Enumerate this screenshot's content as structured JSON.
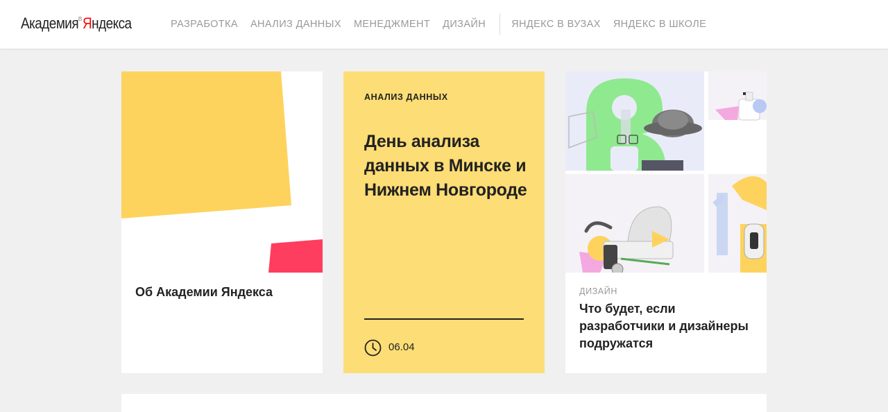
{
  "header": {
    "logo": {
      "word1": "Академия",
      "sup": "в",
      "word2_first": "Я",
      "word2_rest": "ндекса"
    },
    "nav": [
      {
        "label": "РАЗРАБОТКА"
      },
      {
        "label": "АНАЛИЗ ДАННЫХ"
      },
      {
        "label": "МЕНЕДЖМЕНТ"
      },
      {
        "label": "ДИЗАЙН"
      }
    ],
    "nav_secondary": [
      {
        "label": "ЯНДЕКС В ВУЗАХ"
      },
      {
        "label": "ЯНДЕКС В ШКОЛЕ"
      }
    ]
  },
  "cards": {
    "about": {
      "title": "Об Академии Яндекса"
    },
    "event": {
      "tag": "АНАЛИЗ ДАННЫХ",
      "title": "День анализа данных в Минске и Нижнем Новгороде",
      "date": "06.04"
    },
    "article": {
      "tag": "ДИЗАЙН",
      "title": "Что будет, если разработчики и дизайнеры подружатся"
    }
  },
  "colors": {
    "yellow": "#fdd35d",
    "card_yellow": "#fddd75",
    "pink": "#ff3d5f",
    "green": "#8fe98f",
    "background": "#f0f0f0"
  }
}
